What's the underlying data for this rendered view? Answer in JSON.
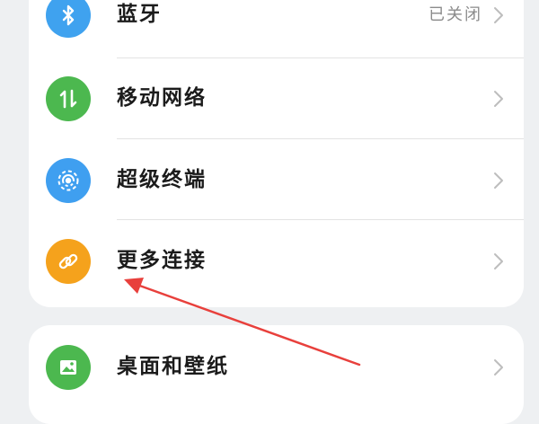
{
  "settings": {
    "items": [
      {
        "label": "蓝牙",
        "status": "已关闭",
        "icon": "bluetooth-icon",
        "color": "#3fa2ef"
      },
      {
        "label": "移动网络",
        "status": "",
        "icon": "mobile-network-icon",
        "color": "#4cb84f"
      },
      {
        "label": "超级终端",
        "status": "",
        "icon": "super-device-icon",
        "color": "#3f9ff0"
      },
      {
        "label": "更多连接",
        "status": "",
        "icon": "link-icon",
        "color": "#f5a21c"
      }
    ],
    "next_item": {
      "label": "桌面和壁纸",
      "icon": "wallpaper-icon",
      "color": "#4cb84f"
    }
  },
  "annotation": {
    "color": "#e8403c"
  },
  "colors": {
    "background": "#eef0f2",
    "card": "#ffffff",
    "chevron": "#bdbdbd"
  }
}
